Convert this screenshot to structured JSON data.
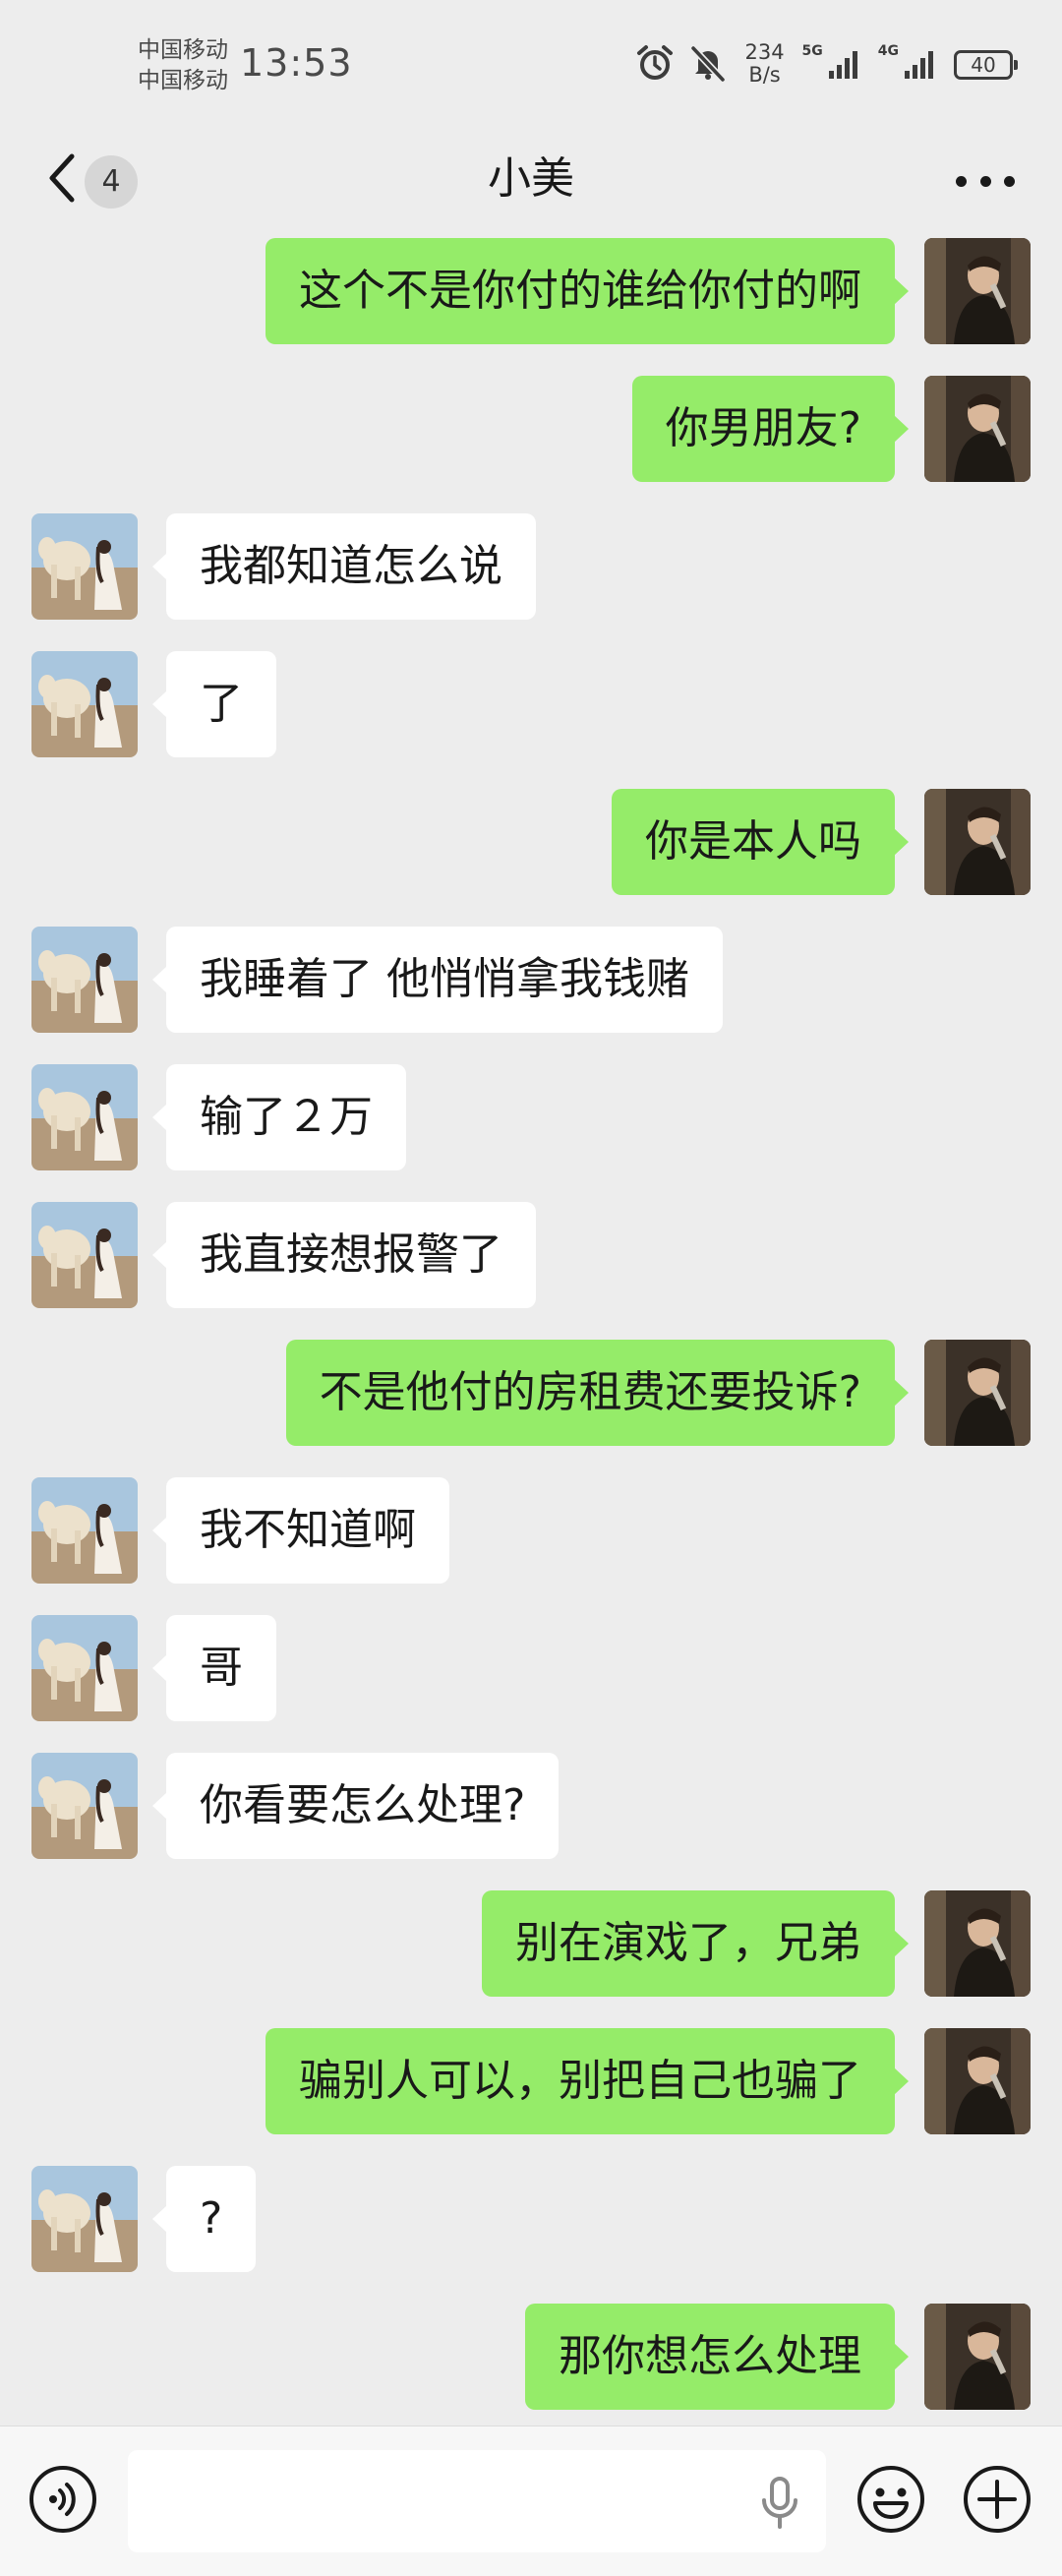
{
  "status_bar": {
    "carrier_1": "中国移动",
    "carrier_2": "中国移动",
    "time": "13:53",
    "net_speed_value": "234",
    "net_speed_unit": "B/s",
    "signal_1_label": "5G",
    "signal_2_label": "4G",
    "battery_level": "40",
    "icons": [
      "alarm-icon",
      "mute-icon",
      "signal-5g-icon",
      "signal-4g-icon",
      "battery-icon"
    ]
  },
  "header": {
    "back_icon": "chevron-left-icon",
    "unread_count": "4",
    "title": "小美",
    "more_icon": "more-dots-icon"
  },
  "messages": [
    {
      "side": "outgoing",
      "text": "这个不是你付的谁给你付的啊"
    },
    {
      "side": "outgoing",
      "text": "你男朋友?"
    },
    {
      "side": "incoming",
      "text": "我都知道怎么说"
    },
    {
      "side": "incoming",
      "text": "了"
    },
    {
      "side": "outgoing",
      "text": "你是本人吗"
    },
    {
      "side": "incoming",
      "text": "我睡着了 他悄悄拿我钱赌"
    },
    {
      "side": "incoming",
      "text": "输了２万"
    },
    {
      "side": "incoming",
      "text": "我直接想报警了"
    },
    {
      "side": "outgoing",
      "text": "不是他付的房租费还要投诉?"
    },
    {
      "side": "incoming",
      "text": "我不知道啊"
    },
    {
      "side": "incoming",
      "text": "哥"
    },
    {
      "side": "incoming",
      "text": "你看要怎么处理?"
    },
    {
      "side": "outgoing",
      "text": "别在演戏了，兄弟"
    },
    {
      "side": "outgoing",
      "text": "骗别人可以，别把自己也骗了"
    },
    {
      "side": "incoming",
      "text": "?"
    },
    {
      "side": "outgoing",
      "text": "那你想怎么处理"
    }
  ],
  "input_bar": {
    "voice_icon": "voice-mode-icon",
    "input_value": "",
    "mic_icon": "microphone-icon",
    "emoji_icon": "emoji-icon",
    "plus_icon": "plus-icon"
  },
  "colors": {
    "background": "#ededed",
    "outgoing_bubble": "#95ec69",
    "incoming_bubble": "#ffffff"
  }
}
